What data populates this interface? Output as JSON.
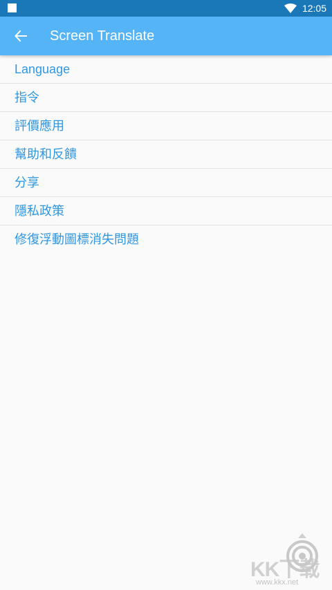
{
  "status_bar": {
    "time": "12:05",
    "icons": [
      "notification-square-icon",
      "wifi-icon"
    ]
  },
  "app_bar": {
    "title": "Screen Translate",
    "back_icon": "arrow-left-icon"
  },
  "menu": {
    "items": [
      {
        "label": "Language"
      },
      {
        "label": "指令"
      },
      {
        "label": "評價應用"
      },
      {
        "label": "幫助和反饋"
      },
      {
        "label": "分享"
      },
      {
        "label": "隱私政策"
      },
      {
        "label": "修復浮動圖標消失問題"
      }
    ]
  },
  "watermark": {
    "brand": "KK下载",
    "url": "www.kkx.net"
  },
  "colors": {
    "status_bar": "#1a78b8",
    "app_bar": "#54b4f5",
    "menu_text": "#3197e0",
    "background": "#fafafa",
    "divider": "#e2e2e2"
  }
}
